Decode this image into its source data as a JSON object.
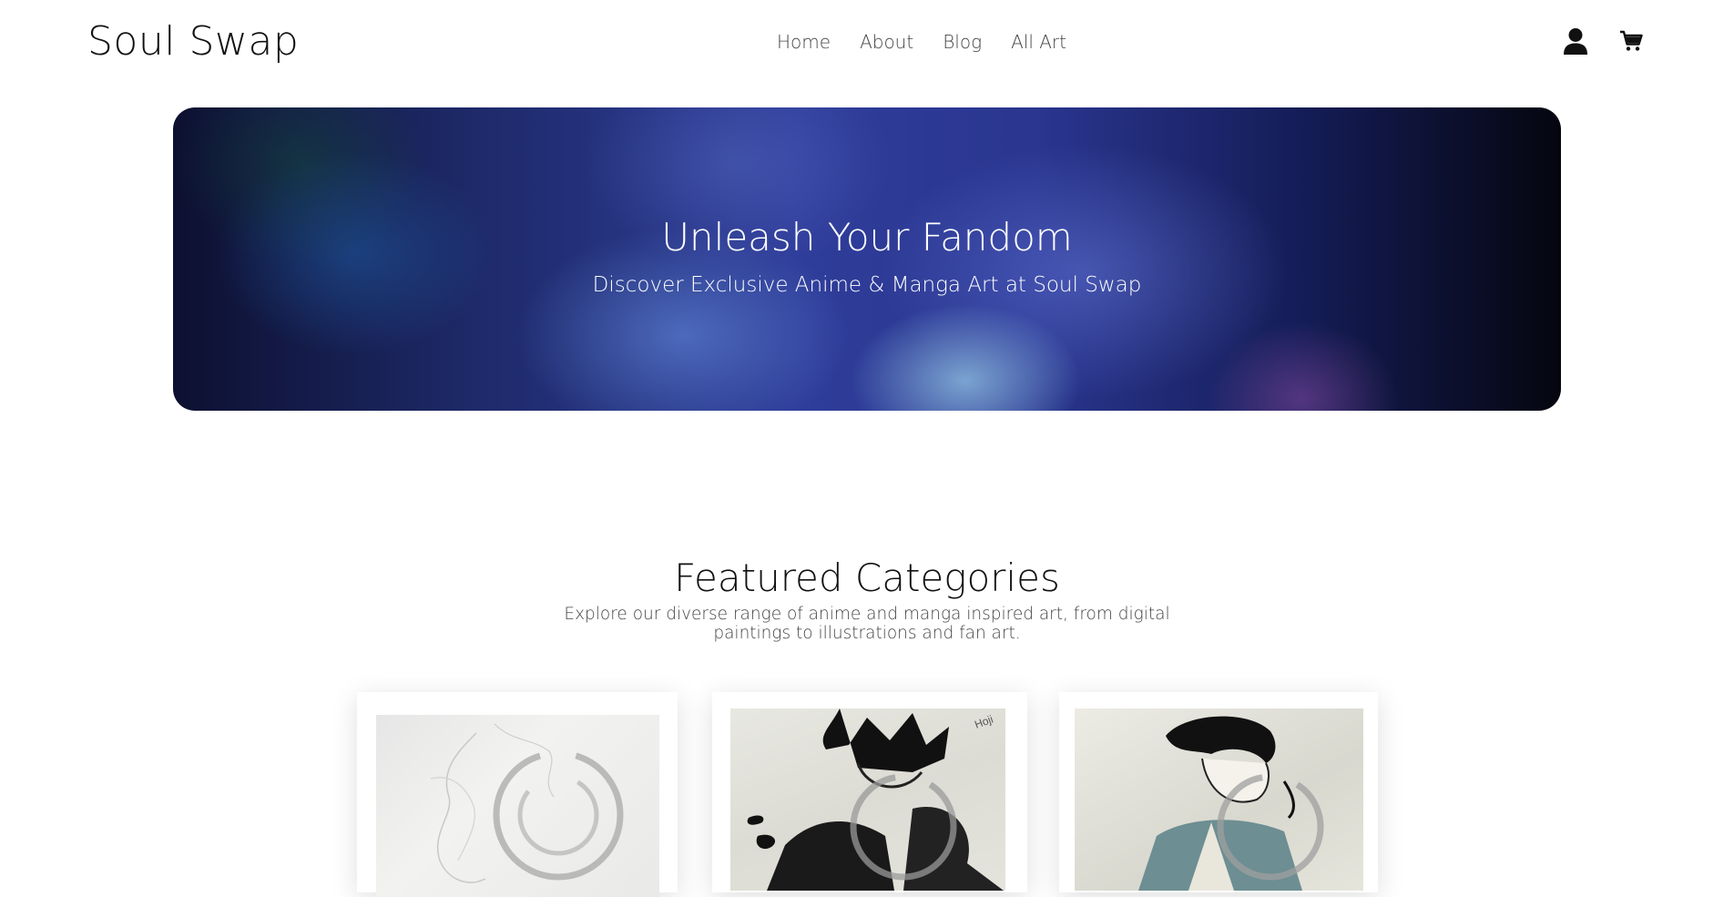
{
  "site": {
    "logo": "Soul Swap"
  },
  "nav": {
    "items": [
      {
        "label": "Home"
      },
      {
        "label": "About"
      },
      {
        "label": "Blog"
      },
      {
        "label": "All Art"
      }
    ]
  },
  "header_icons": [
    "user-icon",
    "cart-icon"
  ],
  "hero": {
    "title": "Unleash Your Fandom",
    "subtitle": "Discover Exclusive Anime & Manga Art at Soul Swap"
  },
  "featured": {
    "title": "Featured Categories",
    "description": "Explore our diverse range of anime and manga inspired art, from digital paintings to illustrations and fan art."
  },
  "categories": [
    {
      "image": "pencil-sketch-artwork"
    },
    {
      "image": "ink-manga-character-artwork"
    },
    {
      "image": "ink-manga-character-artwork-colored"
    }
  ]
}
